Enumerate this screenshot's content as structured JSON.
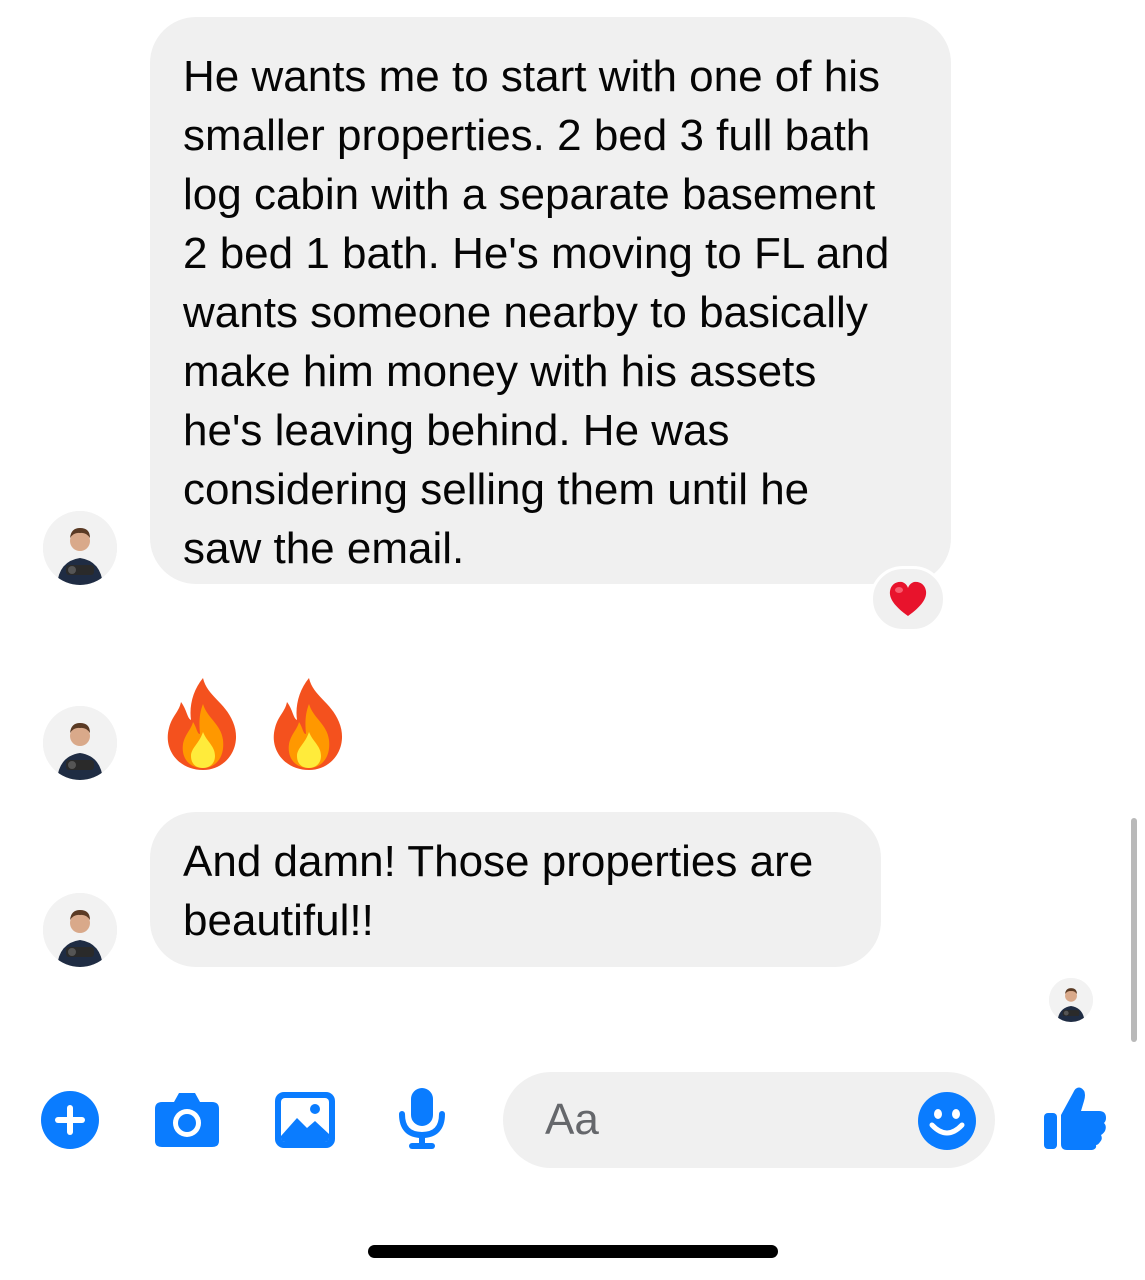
{
  "conversation": {
    "messages": [
      {
        "text": "He wants me to start with one of his\nsmaller properties. 2 bed 3 full bath\nlog cabin with a separate basement\n2 bed 1 bath. He's moving to FL and\nwants someone nearby to basically\nmake him money with his assets\nhe's leaving behind. He was\nconsidering selling them until he\nsaw the email.",
        "reaction": "heart-emoji"
      },
      {
        "emoji": [
          "fire-emoji",
          "fire-emoji"
        ]
      },
      {
        "text": "And damn! Those properties are\nbeautiful!!"
      }
    ],
    "read_receipt": "avatar"
  },
  "composer": {
    "placeholder": "Aa",
    "icons": [
      "plus-icon",
      "camera-icon",
      "image-icon",
      "microphone-icon",
      "emoji-icon",
      "thumbs-up-icon"
    ]
  },
  "colors": {
    "accent": "#0a7cff",
    "bubble": "#f0f0f0",
    "reaction_heart": "#e8132c"
  }
}
